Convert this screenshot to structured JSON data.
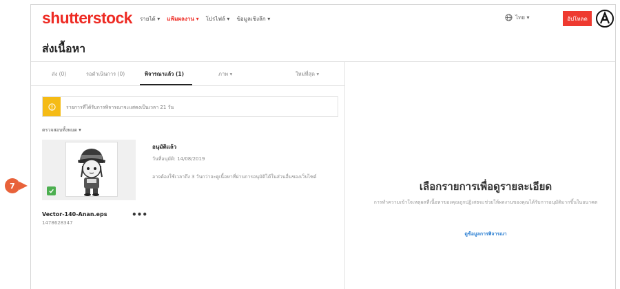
{
  "header": {
    "logo": "shutterstock",
    "nav": [
      {
        "label": "รายได้ ▾",
        "active": false
      },
      {
        "label": "แฟ้มผลงาน ▾",
        "active": true
      },
      {
        "label": "โปรไฟล์ ▾",
        "active": false
      },
      {
        "label": "ข้อมูลเชิงลึก ▾",
        "active": false
      }
    ],
    "language": "ไทย ▾",
    "upload_label": "อัปโหลด",
    "brand_color": "#ee2b24"
  },
  "page": {
    "title": "ส่งเนื้อหา"
  },
  "tabs": [
    {
      "label": "ส่ง (0)",
      "active": false
    },
    {
      "label": "รอดำเนินการ (0)",
      "active": false
    },
    {
      "label": "พิจารณาแล้ว (1)",
      "active": true
    }
  ],
  "filters": {
    "media_type": "ภาพ ▾",
    "sort": "ใหม่ที่สุด ▾",
    "review_filter": "ตรวจสอบทั้งหมด ▾"
  },
  "notice": {
    "text": "รายการที่ได้รับการพิจารณาจะแสดงเป็นเวลา 21 วัน",
    "color": "#f5bb15"
  },
  "item": {
    "status_title": "อนุมัติแล้ว",
    "date": "วันที่อนุมัติ: 14/08/2019",
    "description": "อาจต้องใช้เวลาถึง 3 วันกว่าจะดูเนื้อหาที่ผ่านการอนุมัติได้ในส่วนอื่นของเว็บไซต์",
    "filename": "Vector-140-Anan.eps",
    "id": "1478628347",
    "more": "•••"
  },
  "detail": {
    "title": "เลือกรายการเพื่อดูรายละเอียด",
    "text": "การทำความเข้าใจเหตุผลที่เนื้อหาของคุณถูกปฏิเสธจะช่วยให้ผลงานของคุณได้รับการอนุมัติมากขึ้นในอนาคต",
    "link": "ดูข้อมูลการพิจารณา",
    "link_color": "#2b7fd2"
  },
  "callout": {
    "number": "7",
    "color": "#e8623a"
  }
}
